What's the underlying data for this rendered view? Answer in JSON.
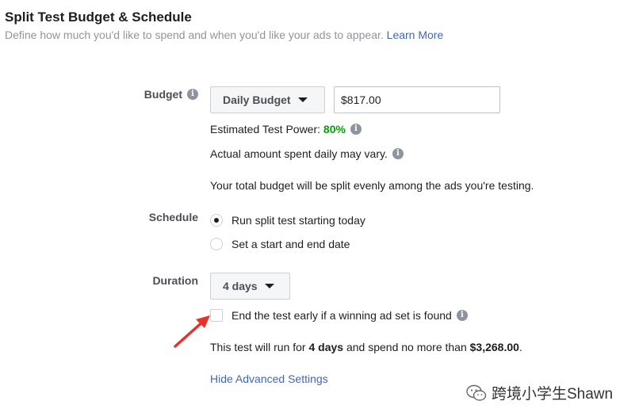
{
  "header": {
    "title": "Split Test Budget & Schedule",
    "subtitle": "Define how much you'd like to spend and when you'd like your ads to appear.",
    "learn_more": "Learn More"
  },
  "budget": {
    "label": "Budget",
    "dropdown_value": "Daily Budget",
    "amount": "$817.00",
    "test_power_label": "Estimated Test Power:",
    "test_power_value": "80%",
    "daily_note": "Actual amount spent daily may vary.",
    "split_note": "Your total budget will be split evenly among the ads you're testing.",
    "power_color": "#00a400"
  },
  "schedule": {
    "label": "Schedule",
    "options": [
      {
        "label": "Run split test starting today",
        "checked": true
      },
      {
        "label": "Set a start and end date",
        "checked": false
      }
    ]
  },
  "duration": {
    "label": "Duration",
    "dropdown_value": "4 days",
    "end_early_label": "End the test early if a winning ad set is found",
    "end_early_checked": false,
    "summary_prefix": "This test will run for",
    "summary_days": "4 days",
    "summary_middle": "and spend no more than",
    "summary_amount": "$3,268.00",
    "summary_suffix": "."
  },
  "advanced": {
    "link": "Hide Advanced Settings"
  },
  "watermark": {
    "text": "跨境小学生Shawn"
  },
  "colors": {
    "link": "#4267b2",
    "arrow": "#e5332a"
  }
}
